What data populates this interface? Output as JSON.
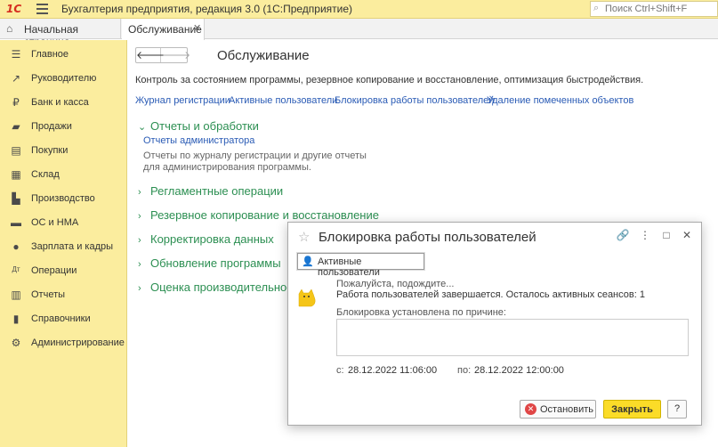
{
  "titlebar": {
    "logo": "1С",
    "title": "Бухгалтерия предприятия, редакция 3.0  (1С:Предприятие)",
    "search_placeholder": "Поиск Ctrl+Shift+F"
  },
  "tabs": {
    "home": "Начальная страница",
    "active": "Обслуживание"
  },
  "sidebar": {
    "items": [
      {
        "label": "Главное",
        "icon": "menu-icon"
      },
      {
        "label": "Руководителю",
        "icon": "trend-icon"
      },
      {
        "label": "Банк и касса",
        "icon": "ruble-icon"
      },
      {
        "label": "Продажи",
        "icon": "cart-icon"
      },
      {
        "label": "Покупки",
        "icon": "basket-icon"
      },
      {
        "label": "Склад",
        "icon": "warehouse-icon"
      },
      {
        "label": "Производство",
        "icon": "factory-icon"
      },
      {
        "label": "ОС и НМА",
        "icon": "truck-icon"
      },
      {
        "label": "Зарплата и кадры",
        "icon": "person-icon"
      },
      {
        "label": "Операции",
        "icon": "dt-kt-icon"
      },
      {
        "label": "Отчеты",
        "icon": "report-icon"
      },
      {
        "label": "Справочники",
        "icon": "book-icon"
      },
      {
        "label": "Администрирование",
        "icon": "gear-icon"
      }
    ]
  },
  "main": {
    "title": "Обслуживание",
    "description": "Контроль за состоянием программы, резервное копирование и восстановление, оптимизация быстродействия.",
    "links": [
      "Журнал регистрации",
      "Активные пользователи",
      "Блокировка работы пользователей",
      "Удаление помеченных объектов"
    ],
    "sections": [
      {
        "label": "Отчеты и обработки",
        "expanded": true
      },
      {
        "label": "Регламентные операции",
        "expanded": false
      },
      {
        "label": "Резервное копирование и восстановление",
        "expanded": false
      },
      {
        "label": "Корректировка данных",
        "expanded": false
      },
      {
        "label": "Обновление программы",
        "expanded": false
      },
      {
        "label": "Оценка производительности",
        "expanded": false
      }
    ],
    "reports_link": "Отчеты администратора",
    "reports_desc": "Отчеты по журналу регистрации и другие отчеты для администрирования программы."
  },
  "dialog": {
    "title": "Блокировка работы пользователей",
    "users_button": "Активные пользователи",
    "wait_text": "Пожалуйста, подождите...",
    "status_text": "Работа пользователей завершается. Осталось активных сеансов: 1",
    "reason_label": "Блокировка установлена по причине:",
    "reason_value": "",
    "from_label": "с:",
    "from_value": "28.12.2022 11:06:00",
    "to_label": "по:",
    "to_value": "28.12.2022 12:00:00",
    "stop_button": "Остановить",
    "close_button": "Закрыть",
    "help_button": "?"
  }
}
